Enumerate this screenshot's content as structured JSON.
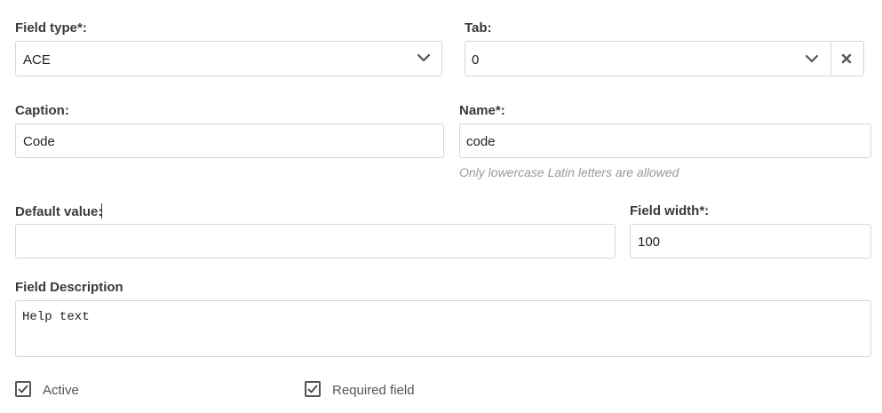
{
  "field_type": {
    "label": "Field type*:",
    "selected": "ACE"
  },
  "tab": {
    "label": "Tab:",
    "selected": "0"
  },
  "caption": {
    "label": "Caption:",
    "value": "Code"
  },
  "name": {
    "label": "Name*:",
    "value": "code",
    "hint": "Only lowercase Latin letters are allowed"
  },
  "default_value": {
    "label": "Default value:",
    "value": ""
  },
  "field_width": {
    "label": "Field width*:",
    "value": "100"
  },
  "field_description": {
    "label": "Field Description",
    "value": "Help text"
  },
  "active": {
    "label": "Active",
    "checked": true
  },
  "required_field": {
    "label": "Required field",
    "checked": true
  },
  "icons": {
    "dropdown": "chevron-down-icon",
    "clear": "close-icon",
    "checkbox": "check-icon"
  },
  "colors": {
    "border": "#d6d6d6",
    "hint": "#999999",
    "label": "#3a3a3a"
  }
}
